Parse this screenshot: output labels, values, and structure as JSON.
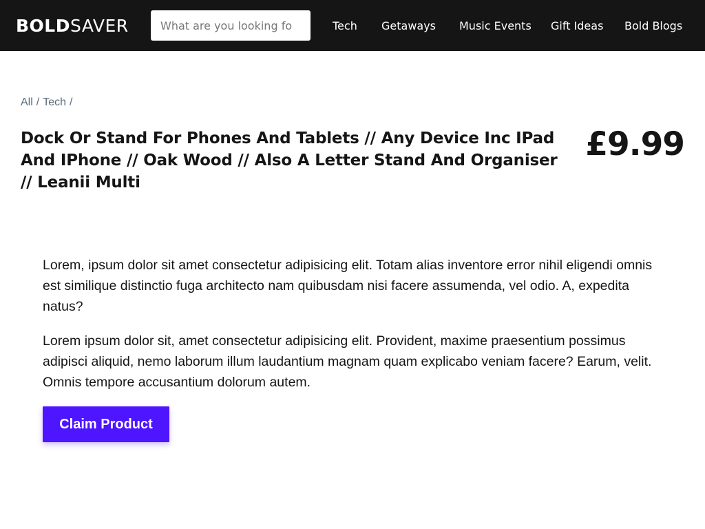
{
  "header": {
    "logo_bold": "BOLD",
    "logo_thin": "SAVER",
    "search_placeholder": "What are you looking fo",
    "nav": [
      "Tech",
      "Getaways",
      "Music Events",
      "Gift Ideas",
      "Bold Blogs"
    ]
  },
  "breadcrumb": [
    "All",
    "/",
    "Tech",
    "/"
  ],
  "product": {
    "title": "Dock Or Stand For Phones And Tablets // Any Device Inc IPad And IPhone // Oak Wood // Also A Letter Stand And Organiser // Leanii Multi",
    "price": "£9.99",
    "description": [
      "Lorem, ipsum dolor sit amet consectetur adipisicing elit. Totam alias inventore error nihil eligendi omnis est similique distinctio fuga architecto nam quibusdam nisi facere assumenda, vel odio. A, expedita natus?",
      "Lorem ipsum dolor sit, amet consectetur adipisicing elit. Provident, maxime praesentium possimus adipisci aliquid, nemo laborum illum laudantium magnam quam explicabo veniam facere? Earum, velit. Omnis tempore accusantium dolorum autem."
    ],
    "claim_label": "Claim Product"
  },
  "colors": {
    "header_bg": "#151515",
    "accent": "#4e15ff",
    "breadcrumb": "#5a6a7a"
  }
}
